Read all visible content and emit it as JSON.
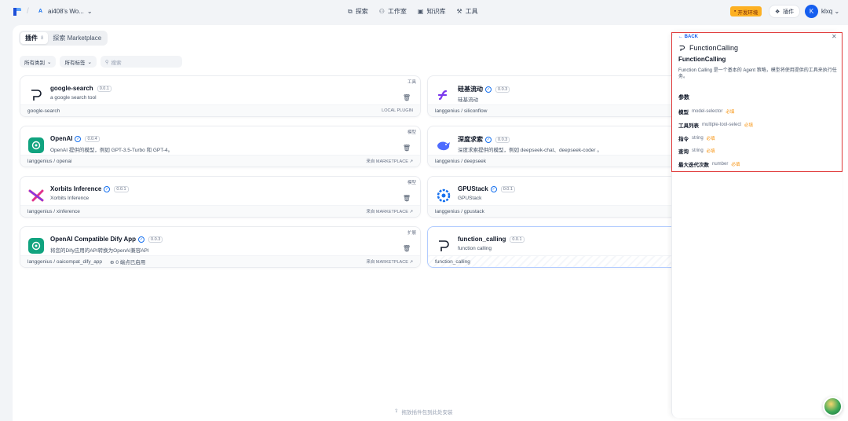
{
  "header": {
    "workspace_badge": "A",
    "workspace_name": "ai408's Wo...",
    "nav": [
      {
        "icon": "compass-icon",
        "label": "探索"
      },
      {
        "icon": "robot-icon",
        "label": "工作室"
      },
      {
        "icon": "book-icon",
        "label": "知识库"
      },
      {
        "icon": "tools-icon",
        "label": "工具"
      }
    ],
    "env_label": "开发环境",
    "plugins_label": "插件",
    "avatar_letter": "K",
    "username": "klxq"
  },
  "tabs": [
    {
      "label": "插件",
      "count": "8",
      "active": true
    },
    {
      "label": "探索 Marketplace",
      "count": "",
      "active": false
    }
  ],
  "filters": {
    "category": "所有类别",
    "tags": "所有标签",
    "search_placeholder": "搜索"
  },
  "plugins": [
    {
      "name": "google-search",
      "version": "0.0.1",
      "verified": false,
      "desc": "a google search tool",
      "tag": "工具",
      "path": "google-search",
      "source": "LOCAL PLUGIN",
      "icon": "function-glyph-icon"
    },
    {
      "name": "硅基流动",
      "version": "0.0.3",
      "verified": true,
      "desc": "硅基流动",
      "tag": "",
      "path": "langgenius / siliconflow",
      "source": "",
      "icon": "siliconflow-logo-icon"
    },
    {
      "name": "OpenAI",
      "version": "0.0.4",
      "verified": true,
      "desc": "OpenAI 提供的模型，例如 GPT-3.5-Turbo 和 GPT-4。",
      "tag": "模型",
      "path": "langgenius / openai",
      "source": "来自 MARKETPLACE ↗",
      "icon": "openai-logo-icon"
    },
    {
      "name": "深度求索",
      "version": "0.0.3",
      "verified": true,
      "desc": "深度求索提供的模型，例如 deepseek-chat、deepseek-coder 。",
      "tag": "",
      "path": "langgenius / deepseek",
      "source": "",
      "icon": "deepseek-logo-icon"
    },
    {
      "name": "Xorbits Inference",
      "version": "0.0.1",
      "verified": true,
      "desc": "Xorbits Inference",
      "tag": "模型",
      "path": "langgenius / xinference",
      "source": "来自 MARKETPLACE ↗",
      "icon": "xorbits-logo-icon"
    },
    {
      "name": "GPUStack",
      "version": "0.0.1",
      "verified": true,
      "desc": "GPUStack",
      "tag": "",
      "path": "langgenius / gpustack",
      "source": "",
      "icon": "gpustack-logo-icon"
    },
    {
      "name": "OpenAI Compatible Dify App",
      "version": "0.0.3",
      "verified": true,
      "desc": "将您的Dify应用的API转换为OpenAI兼容API",
      "tag": "扩展",
      "path": "langgenius / oaicompat_dify_app",
      "endpoints": "0 端点已启用",
      "source": "来自 MARKETPLACE ↗",
      "icon": "openai-logo-icon"
    },
    {
      "name": "function_calling",
      "version": "0.0.1",
      "verified": false,
      "desc": "function calling",
      "tag": "",
      "path": "function_calling",
      "source": "",
      "icon": "function-glyph-icon"
    }
  ],
  "detail": {
    "back": "← BACK",
    "title": "FunctionCalling",
    "subtitle": "FunctionCalling",
    "desc": "Function Calling 是一个基本的 Agent 策略，模型将使用提供的工具来执行任务。",
    "params_label": "参数",
    "required_label": "必填",
    "params": [
      {
        "name": "模型",
        "type": "model-selector"
      },
      {
        "name": "工具列表",
        "type": "multiple-tool-select"
      },
      {
        "name": "指令",
        "type": "string"
      },
      {
        "name": "查询",
        "type": "string"
      },
      {
        "name": "最大迭代次数",
        "type": "number"
      }
    ]
  },
  "hint": "拖放插件包到此处安装",
  "colors": {
    "accent": "#155eef",
    "highlight_border": "#e03a3a",
    "required": "#f79009",
    "env_badge": "#fdb022"
  }
}
